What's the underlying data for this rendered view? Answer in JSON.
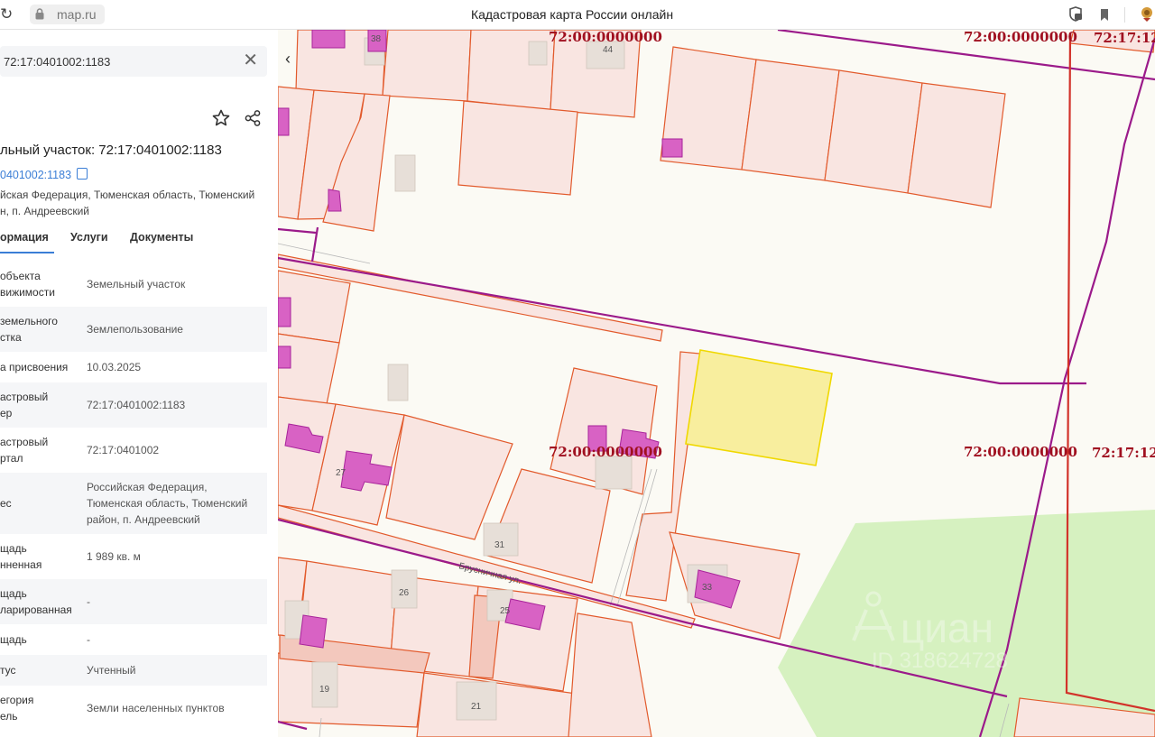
{
  "browser": {
    "url": "map.ru",
    "title": "Кадастровая карта России онлайн"
  },
  "sidebar": {
    "search_value": "72:17:0401002:1183",
    "object_title": "льный участок: 72:17:0401002:1183",
    "object_link": "0401002:1183",
    "address_line1": "йская Федерация, Тюменская область, Тюменский",
    "address_line2": "н, п. Андреевский",
    "tabs": [
      "ормация",
      "Услуги",
      "Документы"
    ],
    "rows": [
      {
        "label": [
          "объекта",
          "вижимости"
        ],
        "value": [
          "Земельный участок"
        ]
      },
      {
        "label": [
          "земельного",
          "стка"
        ],
        "value": [
          "Землепользование"
        ]
      },
      {
        "label": [
          "а присвоения"
        ],
        "value": [
          "10.03.2025"
        ]
      },
      {
        "label": [
          "астровый",
          "ер"
        ],
        "value": [
          "72:17:0401002:1183"
        ]
      },
      {
        "label": [
          "астровый",
          "ртал"
        ],
        "value": [
          "72:17:0401002"
        ]
      },
      {
        "label": [
          "ес"
        ],
        "value": [
          "Российская Федерация,",
          "Тюменская область, Тюменский",
          "район, п. Андреевский"
        ]
      },
      {
        "label": [
          "щадь",
          "нненная"
        ],
        "value": [
          "1 989 кв. м"
        ]
      },
      {
        "label": [
          "щадь",
          "ларированная"
        ],
        "value": [
          "-"
        ]
      },
      {
        "label": [
          "щадь"
        ],
        "value": [
          "-"
        ]
      },
      {
        "label": [
          "тус"
        ],
        "value": [
          "Учтенный"
        ]
      },
      {
        "label": [
          "егория",
          "ель"
        ],
        "value": [
          "Земли населенных пунктов"
        ]
      }
    ]
  },
  "map": {
    "cadastral_labels": [
      "72:00:0000000",
      "72:00:0000000",
      "72:17:12",
      "72:00:0000000",
      "72:00:0000000",
      "72:17:12"
    ],
    "house_numbers": [
      "38",
      "44",
      "27",
      "31",
      "26",
      "25",
      "33",
      "19",
      "21"
    ],
    "street_label": "Брусничная ул.",
    "watermark": "циан",
    "watermark_id": "ID 318624728",
    "colors": {
      "parcel_fill": "#f9e5e1",
      "parcel_stroke": "#e25a2c",
      "building_fill": "#d860c0",
      "boundary": "#9b1a8a",
      "selected_fill": "#f8ee9e",
      "selected_stroke": "#f0d800",
      "green_zone": "#d4f0bc"
    }
  },
  "icons": [
    "reload-icon",
    "lock-icon",
    "shield-icon",
    "bookmark-icon",
    "profile-icon",
    "star-icon",
    "share-icon",
    "copy-icon",
    "close-icon",
    "chevron-left-icon"
  ]
}
